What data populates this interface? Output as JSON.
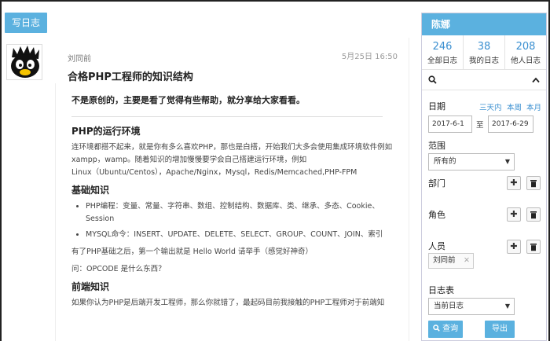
{
  "toolbar": {
    "write_label": "写日志"
  },
  "post": {
    "author": "刘同前",
    "date": "5月25日 16:50",
    "title": "合格PHP工程师的知识结构",
    "intro": "不是原创的，主要是看了觉得有些帮助，就分享给大家看看。",
    "sections": [
      {
        "heading": "PHP的运行环境"
      },
      {
        "heading": "基础知识"
      },
      {
        "heading": "前端知识"
      }
    ],
    "env_para1": "连环境都搭不起来，就是你有多么喜欢PHP，那也是白搭，开始我们大多会使用集成环境软件例如xampp，wamp。随着知识的增加慢慢要学会自己搭建运行环境，例如",
    "env_para2": "Linux（Ubuntu/Centos），Apache/Nginx，Mysql，Redis/Memcached,PHP-FPM",
    "bullets": [
      "PHP编程：变量、常量、字符串、数组、控制结构、数据库、类、继承、多态、Cookie、Session",
      "MYSQL命令：INSERT、UPDATE、DELETE、SELECT、GROUP、COUNT、JOIN、索引"
    ],
    "after_basics_1": "有了PHP基础之后，第一个输出就是 Hello World 请举手（感觉好神奇）",
    "after_basics_2": "问：OPCODE 是什么东西？",
    "frontend_para": "如果你认为PHP是后端开发工程师，那么你就错了，最起码目前我接触的PHP工程师对于前端知"
  },
  "sidebar": {
    "user_name": "陈娜",
    "stats": [
      {
        "num": "246",
        "label": "全部日志"
      },
      {
        "num": "38",
        "label": "我的日志"
      },
      {
        "num": "208",
        "label": "他人日志"
      }
    ],
    "date_label": "日期",
    "quick_ranges": [
      "三天内",
      "本周",
      "本月"
    ],
    "date_from": "2017-6-1",
    "date_sep": "至",
    "date_to": "2017-6-29",
    "scope_label": "范围",
    "scope_value": "所有的",
    "dept_label": "部门",
    "role_label": "角色",
    "person_label": "人员",
    "person_tag": "刘同前",
    "log_table_label": "日志表",
    "log_table_value": "当前日志",
    "query_label": "查询",
    "export_label": "导出"
  },
  "colors": {
    "accent": "#5bb1df",
    "link": "#3a8fd0"
  }
}
